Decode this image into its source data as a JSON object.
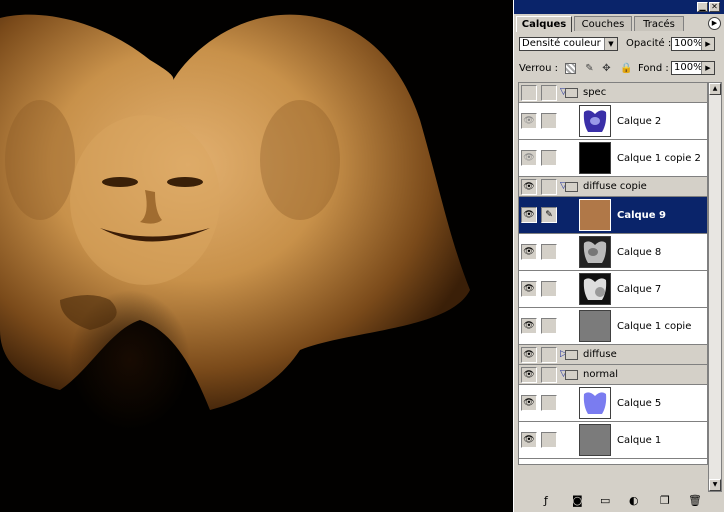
{
  "panel": {
    "tabs": [
      {
        "label": "Calques",
        "active": true
      },
      {
        "label": "Couches",
        "active": false
      },
      {
        "label": "Tracés",
        "active": false
      }
    ],
    "blend_mode": "Densité couleur +",
    "opacity_label": "Opacité :",
    "opacity_value": "100%",
    "lock_label": "Verrou :",
    "fill_label": "Fond :",
    "fill_value": "100%",
    "lock_icons": [
      "transparency-lock-icon",
      "brush-lock-icon",
      "move-lock-icon",
      "padlock-icon"
    ],
    "bottom_icons": [
      "layer-style-icon",
      "mask-icon",
      "new-group-icon",
      "adjustment-layer-icon",
      "new-layer-icon",
      "trash-icon"
    ]
  },
  "layers": [
    {
      "type": "group",
      "name": "spec",
      "expanded": true,
      "visible_dim": true
    },
    {
      "type": "layer",
      "name": "Calque 2",
      "thumb": "purple-face",
      "visible_dim": true
    },
    {
      "type": "layer",
      "name": "Calque 1 copie 2",
      "thumb": "black",
      "visible_dim": true
    },
    {
      "type": "group",
      "name": "diffuse copie",
      "expanded": true
    },
    {
      "type": "layer",
      "name": "Calque 9",
      "thumb": "brown",
      "selected": true
    },
    {
      "type": "layer",
      "name": "Calque 8",
      "thumb": "grey-face"
    },
    {
      "type": "layer",
      "name": "Calque 7",
      "thumb": "grey-face-light"
    },
    {
      "type": "layer",
      "name": "Calque 1 copie",
      "thumb": "grey"
    },
    {
      "type": "group",
      "name": "diffuse",
      "expanded": false
    },
    {
      "type": "group",
      "name": "normal",
      "expanded": true
    },
    {
      "type": "layer",
      "name": "Calque 5",
      "thumb": "blue-face"
    },
    {
      "type": "layer",
      "name": "Calque 1",
      "thumb": "grey"
    }
  ],
  "colors": {
    "selection": "#0a246a",
    "panel_bg": "#d4d0c8",
    "skin": "#c8914a"
  }
}
